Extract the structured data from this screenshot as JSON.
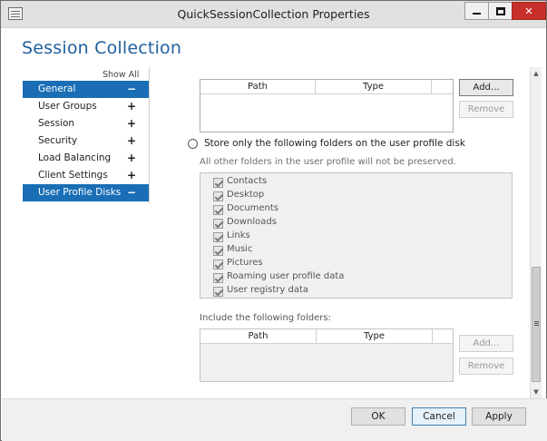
{
  "window": {
    "title": "QuickSessionCollection Properties",
    "controls": {
      "close_glyph": "✕"
    }
  },
  "page_title": "Session Collection",
  "nav": {
    "show_all": "Show All",
    "items": [
      {
        "label": "General",
        "sign": "−",
        "selected": true
      },
      {
        "label": "User Groups",
        "sign": "+"
      },
      {
        "label": "Session",
        "sign": "+"
      },
      {
        "label": "Security",
        "sign": "+"
      },
      {
        "label": "Load Balancing",
        "sign": "+"
      },
      {
        "label": "Client Settings",
        "sign": "+"
      },
      {
        "label": "User Profile Disks",
        "sign": "−",
        "selected": true
      }
    ]
  },
  "top_grid": {
    "columns": [
      "Path",
      "Type"
    ],
    "add_label": "Add...",
    "remove_label": "Remove"
  },
  "store_option": {
    "label": "Store only the following folders on the user profile disk",
    "hint": "All other folders in the user profile will not be preserved.",
    "folders": [
      "Contacts",
      "Desktop",
      "Documents",
      "Downloads",
      "Links",
      "Music",
      "Pictures",
      "Roaming user profile data",
      "User registry data"
    ]
  },
  "include_section": {
    "label": "Include the following folders:",
    "columns": [
      "Path",
      "Type"
    ],
    "add_label": "Add...",
    "remove_label": "Remove"
  },
  "footer": {
    "ok_label": "OK",
    "cancel_label": "Cancel",
    "apply_label": "Apply"
  },
  "colors": {
    "accent": "#1a6eb5",
    "title": "#1f5f9f",
    "close": "#c7302a"
  }
}
